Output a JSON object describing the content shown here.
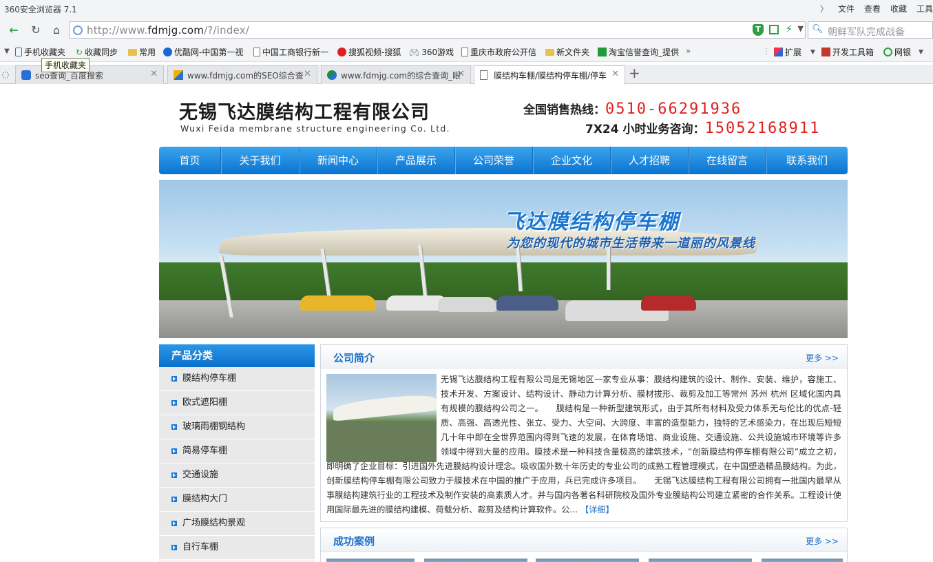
{
  "browser": {
    "app_title": "360安全浏览器 7.1",
    "menu": [
      "文件",
      "查看",
      "收藏",
      "工具"
    ],
    "url_prefix": "http://www.",
    "url_domain": "fdmjg.com",
    "url_suffix": "/?/index/",
    "search_text": "朝鲜军队完成战备",
    "bookmarks": [
      "手机收藏夹",
      "收藏同步",
      "常用",
      "优酷网-中国第一视",
      "中国工商银行新一",
      "搜狐视频-搜狐",
      "360游戏",
      "重庆市政府公开信",
      "新文件夹",
      "淘宝信誉查询_提供"
    ],
    "bookmarks_right": [
      "扩展",
      "开发工具箱",
      "网银"
    ],
    "tooltip": "手机收藏夹",
    "tabs": [
      {
        "label": "seo查询_百度搜索"
      },
      {
        "label": "www.fdmjg.com的SEO综合查"
      },
      {
        "label": "www.fdmjg.com的综合查询_眼"
      },
      {
        "label": "膜结构车棚/膜结构停车棚/停车"
      }
    ]
  },
  "header": {
    "company_cn": "无锡飞达膜结构工程有限公司",
    "company_en": "Wuxi Feida membrane structure engineering Co. Ltd.",
    "hotline_label": "全国销售热线：",
    "hotline_number": "0510-66291936",
    "consult_label": "7X24 小时业务咨询：",
    "consult_number": "15052168911"
  },
  "nav": [
    "首页",
    "关于我们",
    "新闻中心",
    "产品展示",
    "公司荣誉",
    "企业文化",
    "人才招聘",
    "在线留言",
    "联系我们"
  ],
  "banner": {
    "title": "飞达膜结构停车棚",
    "subtitle": "为您的现代的城市生活带来一道丽的风景线"
  },
  "sidebar": {
    "title": "产品分类",
    "categories": [
      "膜结构停车棚",
      "欧式遮阳棚",
      "玻璃雨棚钢结构",
      "简易停车棚",
      "交通设施",
      "膜结构大门",
      "广场膜结构景观",
      "自行车棚"
    ]
  },
  "about": {
    "title": "公司简介",
    "more": "更多 >>",
    "text": "无锡飞达膜结构工程有限公司是无锡地区一家专业从事：膜结构建筑的设计、制作、安装、维护，容施工、技术开发、方案设计、结构设计、静动力计算分析、膜材拔形、裁剪及加工等常州 苏州 杭州 区域化国内具有规模的膜结构公司之一。　　膜结构是一种新型建筑形式，由于其所有材料及受力体系无与伦比的优点-轻质、高强、高透光性、张立、受力、大空间、大跨度、丰富的造型能力，独特的艺术感染力，在出现后短短几十年中即在全世界范围内得到飞速的发展，在体育场馆、商业设施、交通设施、公共设施城市环境等许多领域中得到大量的应用。膜技术是一种科技含量极高的建筑技术，“创新膜结构停车棚有限公司”成立之初，即明确了企业目标：引进国外先进膜结构设计理念。吸收国外数十年历史的专业公司的成熟工程管理模式，在中国塑造精品膜结构。为此，创新膜结构停车棚有限公司致力于膜技术在中国的推广于应用，兵已完成许多项目。　　无锡飞达膜结构工程有限公司拥有一批国内最早从事膜结构建筑行业的工程技术及制作安装的高素质人才。并与国内各著名科研院校及国外专业膜结构公司建立紧密的合作关系。工程设计使用国际最先进的膜结构建模、荷载分析、裁剪及结构计算软件。公...",
    "detail_link": "【详细】"
  },
  "cases": {
    "title": "成功案例",
    "more": "更多 >>"
  },
  "colors": {
    "accent_blue": "#0a74d2",
    "hotline_red": "#e02020"
  }
}
